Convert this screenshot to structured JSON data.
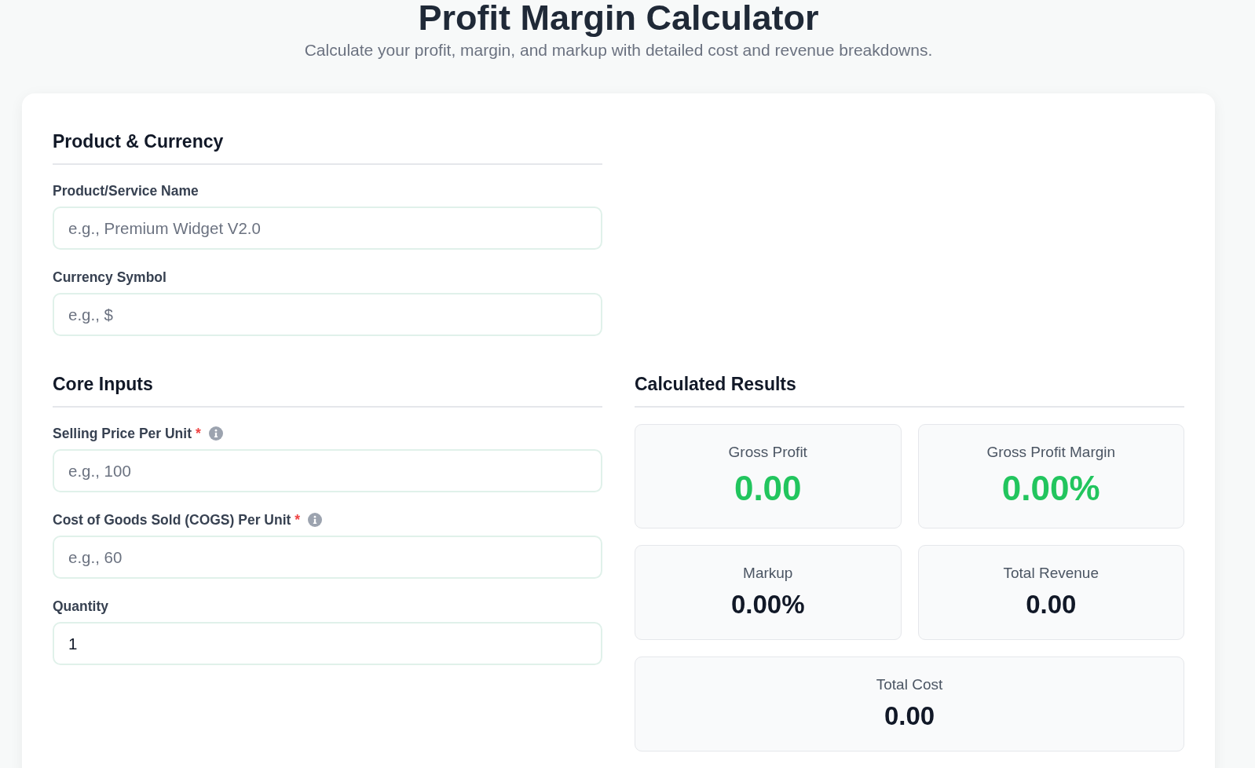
{
  "header": {
    "title": "Profit Margin Calculator",
    "subtitle": "Calculate your profit, margin, and markup with detailed cost and revenue breakdowns."
  },
  "sections": [
    {
      "heading": "Product & Currency",
      "fields": [
        {
          "label": "Product/Service Name",
          "placeholder": "e.g., Premium Widget V2.0",
          "info": false
        },
        {
          "label": "Currency Symbol",
          "placeholder": "e.g., $",
          "info": false
        }
      ]
    },
    {
      "heading": "Core Inputs",
      "fields": [
        {
          "label": "Selling Price Per Unit",
          "required_mark": "*",
          "info": true,
          "placeholder": "e.g., 100"
        },
        {
          "label": "Cost of Goods Sold (COGS) Per Unit",
          "required_mark": "*",
          "info": true,
          "placeholder": "e.g., 60"
        },
        {
          "label": "Quantity",
          "value": "1",
          "info": false
        }
      ]
    }
  ],
  "results": {
    "heading": "Calculated Results",
    "cards": [
      {
        "label": "Gross Profit",
        "value": "0.00",
        "kind": "highlight",
        "full_width": false
      },
      {
        "label": "Gross Profit Margin",
        "value": "0.00%",
        "kind": "highlight",
        "full_width": false
      },
      {
        "label": "Markup",
        "value": "0.00%",
        "kind": "standard",
        "full_width": false
      },
      {
        "label": "Total Revenue",
        "value": "0.00",
        "kind": "standard",
        "full_width": false
      },
      {
        "label": "Total Cost",
        "value": "0.00",
        "kind": "standard",
        "full_width": true
      }
    ]
  }
}
